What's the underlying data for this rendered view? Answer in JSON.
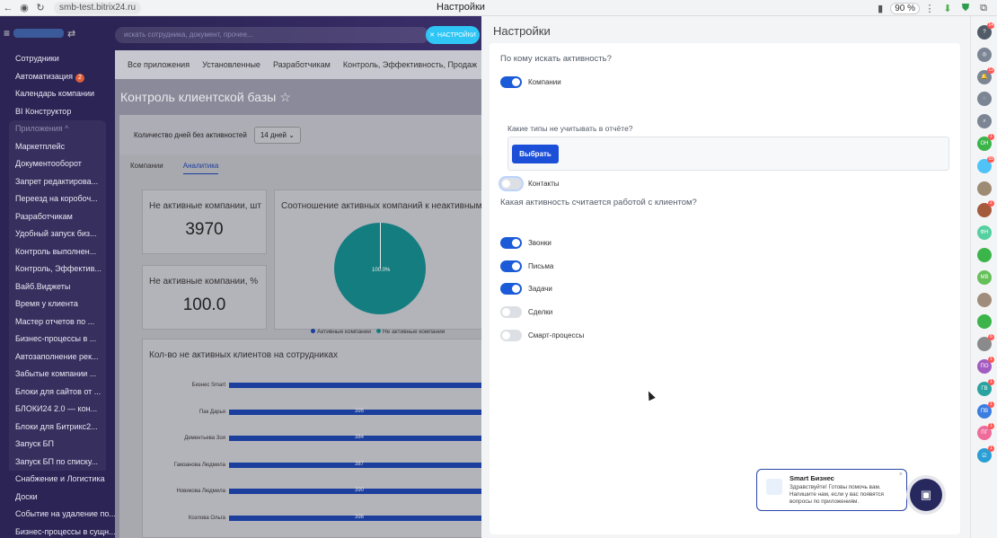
{
  "browser": {
    "url": "smb-test.bitrix24.ru",
    "tab_title": "Настройки",
    "zoom": "90 %"
  },
  "menu": [
    {
      "label": "Сотрудники"
    },
    {
      "label": "Автоматизация",
      "badge": "2"
    },
    {
      "label": "Календарь компании"
    },
    {
      "label": "BI Конструктор"
    },
    {
      "label": "Приложения ^",
      "type": "grouphead"
    },
    {
      "label": "Маркетплейс",
      "type": "group"
    },
    {
      "label": "Документооборот",
      "type": "group"
    },
    {
      "label": "Запрет редактирова...",
      "type": "group"
    },
    {
      "label": "Переезд на коробоч...",
      "type": "group"
    },
    {
      "label": "Разработчикам",
      "type": "group"
    },
    {
      "label": "Удобный запуск биз...",
      "type": "group"
    },
    {
      "label": "Контроль выполнен...",
      "type": "group"
    },
    {
      "label": "Контроль, Эффектив...",
      "type": "group"
    },
    {
      "label": "Вайб.Виджеты",
      "type": "group"
    },
    {
      "label": "Время у клиента",
      "type": "group"
    },
    {
      "label": "Мастер отчетов по ...",
      "type": "group"
    },
    {
      "label": "Бизнес-процессы в ...",
      "type": "group"
    },
    {
      "label": "Автозаполнение рек...",
      "type": "group"
    },
    {
      "label": "Забытые компании ...",
      "type": "group"
    },
    {
      "label": "Блоки для сайтов от ...",
      "type": "group"
    },
    {
      "label": "БЛОКИ24 2.0 — кон...",
      "type": "group"
    },
    {
      "label": "Блоки для Битрикс2...",
      "type": "group"
    },
    {
      "label": "Запуск БП",
      "type": "group"
    },
    {
      "label": "Запуск БП по списку...",
      "type": "group"
    },
    {
      "label": "Снабжение и Логистика"
    },
    {
      "label": "Доски"
    },
    {
      "label": "Событие на удаление по..."
    },
    {
      "label": "Бизнес-процессы в сущн..."
    }
  ],
  "header": {
    "search_placeholder": "искать сотрудника, документ, прочее...",
    "settings_button": "НАСТРОЙКИ"
  },
  "main": {
    "top_tabs": [
      "Все приложения",
      "Установленные",
      "Разработчикам",
      "Контроль, Эффективность, Продаж"
    ],
    "title": "Контроль клиентской базы ☆",
    "days_label": "Количество дней без активностей",
    "days_value": "14 дней ⌄",
    "subtabs": [
      "Компании",
      "Аналитика"
    ],
    "card1_title": "Не активные компании, шт",
    "card1_value": "3970",
    "card2_title": "Не активные компании, %",
    "card2_value": "100.0",
    "pie_title": "Соотношение активных компаний к неактивным",
    "pie_label": "100.0%",
    "legend": [
      "Активные компании",
      "Не активные компании"
    ],
    "legend_colors": [
      "#1c3f9e",
      "#147d80"
    ],
    "bar_title": "Кол-во не активных клиентов на сотрудниках"
  },
  "bars": [
    {
      "name": "Бизнес Smart",
      "value": ""
    },
    {
      "name": "Пак Дарья",
      "value": "395"
    },
    {
      "name": "Дементьева Зоя",
      "value": "384"
    },
    {
      "name": "Гамзанова Людмила",
      "value": "387"
    },
    {
      "name": "Новикова Людмила",
      "value": "390"
    },
    {
      "name": "Козлова Ольга",
      "value": "398"
    }
  ],
  "settings": {
    "title": "Настройки",
    "q1": "По кому искать активность?",
    "companies": "Компании",
    "subq": "Какие типы не учитывать в отчёте?",
    "choose": "Выбрать",
    "contacts": "Контакты",
    "q2": "Какая активность считается работой с клиентом?",
    "toggles": [
      {
        "label": "Звонки",
        "on": true
      },
      {
        "label": "Письма",
        "on": true
      },
      {
        "label": "Задачи",
        "on": true
      },
      {
        "label": "Сделки",
        "on": false
      },
      {
        "label": "Смарт-процессы",
        "on": false
      }
    ]
  },
  "chat": {
    "title": "Smart Бизнес",
    "text": "Здравствуйте! Готовы помочь вам. Напишите нам, если у вас появятся вопросы по приложениям.",
    "close": "×"
  },
  "rail": [
    {
      "icon": "help-icon",
      "text": "?",
      "badge": "14",
      "color": "#525c69"
    },
    {
      "icon": "copilot-icon",
      "text": "◎",
      "color": "#7b8594"
    },
    {
      "icon": "bell-icon",
      "text": "🔔",
      "badge": "12",
      "color": "#7b8594"
    },
    {
      "icon": "chat-icon",
      "text": "◌",
      "color": "#7b8594"
    },
    {
      "icon": "search-icon",
      "text": "⌕",
      "color": "#7b8594"
    },
    {
      "icon": "avatar-on",
      "text": "ОН",
      "badge": "1",
      "color": "#3bb44a"
    },
    {
      "icon": "avatar-2",
      "text": "",
      "badge": "55",
      "color": "#4fc3f7"
    },
    {
      "icon": "avatar-3",
      "text": "",
      "color": "#9e8b73"
    },
    {
      "icon": "avatar-4",
      "text": "",
      "badge": "2",
      "color": "#a65a3c"
    },
    {
      "icon": "avatar-fn",
      "text": "ФН",
      "color": "#55d0a0"
    },
    {
      "icon": "avatar-5",
      "text": "",
      "color": "#3bb44a"
    },
    {
      "icon": "avatar-mv",
      "text": "МВ",
      "color": "#66c05a"
    },
    {
      "icon": "avatar-6",
      "text": "",
      "color": "#a08c7a"
    },
    {
      "icon": "avatar-7",
      "text": "",
      "color": "#3bb44a"
    },
    {
      "icon": "avatar-8",
      "text": "",
      "badge": "6",
      "color": "#8a8a8a"
    },
    {
      "icon": "avatar-po",
      "text": "ПО",
      "badge": "1",
      "color": "#a35cc0"
    },
    {
      "icon": "avatar-gv",
      "text": "ГВ",
      "badge": "1",
      "color": "#2aa3a0"
    },
    {
      "icon": "avatar-pv",
      "text": "ПВ",
      "badge": "1",
      "color": "#3b7ee0"
    },
    {
      "icon": "avatar-pg",
      "text": "ПГ",
      "badge": "1",
      "color": "#ee6c9a"
    },
    {
      "icon": "avatar-task",
      "text": "☑",
      "badge": "1",
      "color": "#2a9fd6"
    }
  ]
}
